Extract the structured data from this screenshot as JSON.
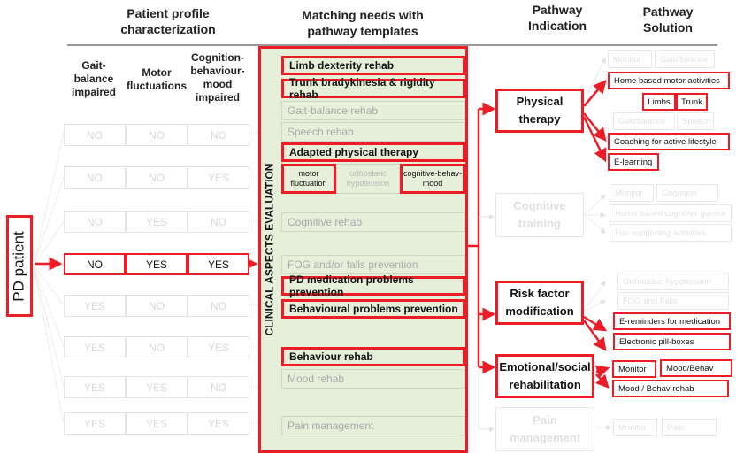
{
  "headers": {
    "profile": "Patient profile characterization",
    "matching": "Matching needs with pathway templates",
    "indication": "Pathway Indication",
    "solution": "Pathway Solution"
  },
  "profile_columns": [
    "Gait-balance impaired",
    "Motor fluctuations",
    "Cognition-behaviour-mood impaired"
  ],
  "patient_label": "PD patient",
  "profile_rows": [
    {
      "values": [
        "NO",
        "NO",
        "NO"
      ],
      "active": false
    },
    {
      "values": [
        "NO",
        "NO",
        "YES"
      ],
      "active": false
    },
    {
      "values": [
        "NO",
        "YES",
        "NO"
      ],
      "active": false
    },
    {
      "values": [
        "NO",
        "YES",
        "YES"
      ],
      "active": true
    },
    {
      "values": [
        "YES",
        "NO",
        "NO"
      ],
      "active": false
    },
    {
      "values": [
        "YES",
        "NO",
        "YES"
      ],
      "active": false
    },
    {
      "values": [
        "YES",
        "YES",
        "NO"
      ],
      "active": false
    },
    {
      "values": [
        "YES",
        "YES",
        "YES"
      ],
      "active": false
    }
  ],
  "clinical_label": "CLINICAL ASPECTS EVALUATION",
  "templates": [
    {
      "label": "Limb dexterity rehab",
      "active": true
    },
    {
      "label": "Trunk bradykinesia & rigidity rehab",
      "active": true
    },
    {
      "label": "Gait-balance rehab",
      "active": false
    },
    {
      "label": "Speech rehab",
      "active": false
    },
    {
      "label": "Adapted physical therapy",
      "active": true
    },
    {
      "label": "Cognitive rehab",
      "active": false
    },
    {
      "label": "FOG and/or falls prevention",
      "active": false
    },
    {
      "label": "PD medication problems prevention",
      "active": true
    },
    {
      "label": "Behavioural problems prevention",
      "active": true
    },
    {
      "label": "Behaviour rehab",
      "active": true
    },
    {
      "label": "Mood rehab",
      "active": false
    },
    {
      "label": "Pain management",
      "active": false
    }
  ],
  "adapted_subtemplates": [
    {
      "label": "motor fluctuation",
      "active": true
    },
    {
      "label": "orthostatic hypotension",
      "active": false
    },
    {
      "label": "cognitive-behav-mood",
      "active": true
    }
  ],
  "indications": [
    {
      "label": "Physical therapy",
      "active": true
    },
    {
      "label": "Cognitive training",
      "active": false
    },
    {
      "label": "Risk factor modification",
      "active": true
    },
    {
      "label": "Emotional/social rehabilitation",
      "active": true
    },
    {
      "label": "Pain management",
      "active": false
    }
  ],
  "solutions": {
    "physical": [
      {
        "label": "Monitor",
        "active": false
      },
      {
        "label": "Gait/Balance",
        "active": false
      },
      {
        "label": "Home based motor activities",
        "active": true
      },
      {
        "label": "Limbs",
        "active": true
      },
      {
        "label": "Trunk",
        "active": true
      },
      {
        "label": "Gait/balance",
        "active": false
      },
      {
        "label": "Speech",
        "active": false
      },
      {
        "label": "Coaching for active lifestyle",
        "active": true
      },
      {
        "label": "E-learning",
        "active": true
      }
    ],
    "cognitive": [
      {
        "label": "Monitor",
        "active": false
      },
      {
        "label": "Cognition",
        "active": false
      },
      {
        "label": "Home based cognitive games",
        "active": false
      },
      {
        "label": "Fun supporting activities",
        "active": false
      }
    ],
    "risk": [
      {
        "label": "Orthostatic hypotension",
        "active": false
      },
      {
        "label": "FOG and Falls",
        "active": false
      },
      {
        "label": "E-reminders for medication",
        "active": true
      },
      {
        "label": "Electronic pill-boxes",
        "active": true
      }
    ],
    "emotional": [
      {
        "label": "Monitor",
        "active": true
      },
      {
        "label": "Mood/Behav",
        "active": true
      },
      {
        "label": "Mood / Behav rehab",
        "active": true
      }
    ],
    "pain": [
      {
        "label": "Monitor",
        "active": false
      },
      {
        "label": "Pain",
        "active": false
      }
    ]
  },
  "colors": {
    "accent_red": "#ee1c24",
    "panel_green": "#e6efda",
    "inactive_gray": "#d8d8d8"
  }
}
